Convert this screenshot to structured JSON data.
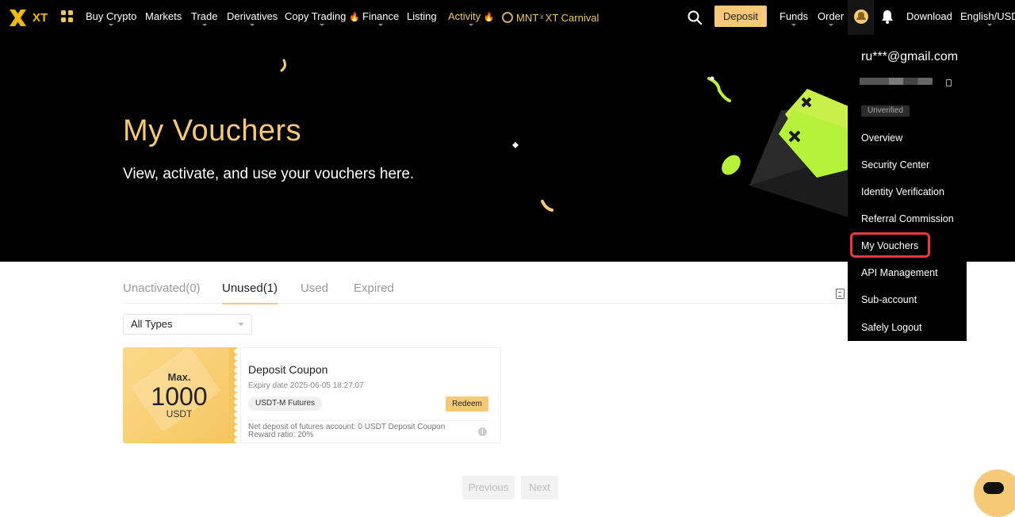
{
  "nav": {
    "brand": "XT",
    "items": [
      {
        "label": "Buy Crypto",
        "dropdown": true
      },
      {
        "label": "Markets",
        "dropdown": false
      },
      {
        "label": "Trade",
        "dropdown": true
      },
      {
        "label": "Derivatives",
        "dropdown": true
      },
      {
        "label": "Copy Trading",
        "dropdown": true
      },
      {
        "label": "Finance",
        "dropdown": true
      },
      {
        "label": "Listing",
        "dropdown": false
      },
      {
        "label": "Activity",
        "dropdown": true
      }
    ],
    "mnt": "MNT",
    "mnt_x": "x",
    "carnival": "XT Carnival",
    "deposit": "Deposit",
    "funds": "Funds",
    "order": "Order",
    "download": "Download",
    "locale": "English/USD"
  },
  "hero": {
    "title": "My Vouchers",
    "subtitle": "View, activate, and use your vouchers here."
  },
  "tabs": [
    "Unactivated(0)",
    "Unused(1)",
    "Used",
    "Expired"
  ],
  "filter": {
    "selected": "All Types"
  },
  "voucher": {
    "max_label": "Max.",
    "amount": "1000",
    "unit": "USDT",
    "name": "Deposit Coupon",
    "expiry": "Expiry date 2025-06-05 18:27:07",
    "tag": "USDT-M Futures",
    "redeem": "Redeem",
    "note_line1": "Net deposit of futures account:  0 USDT  Deposit Coupon",
    "note_line2": "Reward ratio:  20%",
    "info": "i"
  },
  "pagination": {
    "previous": "Previous",
    "next": "Next"
  },
  "account_menu": {
    "email": "ru***@gmail.com",
    "status": "Unverified",
    "items": [
      "Overview",
      "Security Center",
      "Identity Verification",
      "Referral Commission",
      "My Vouchers",
      "API Management",
      "Sub-account",
      "Safely Logout"
    ]
  },
  "colors": {
    "accent": "#f5c977",
    "highlight": "#e8383a",
    "green": "#b6f23a"
  }
}
